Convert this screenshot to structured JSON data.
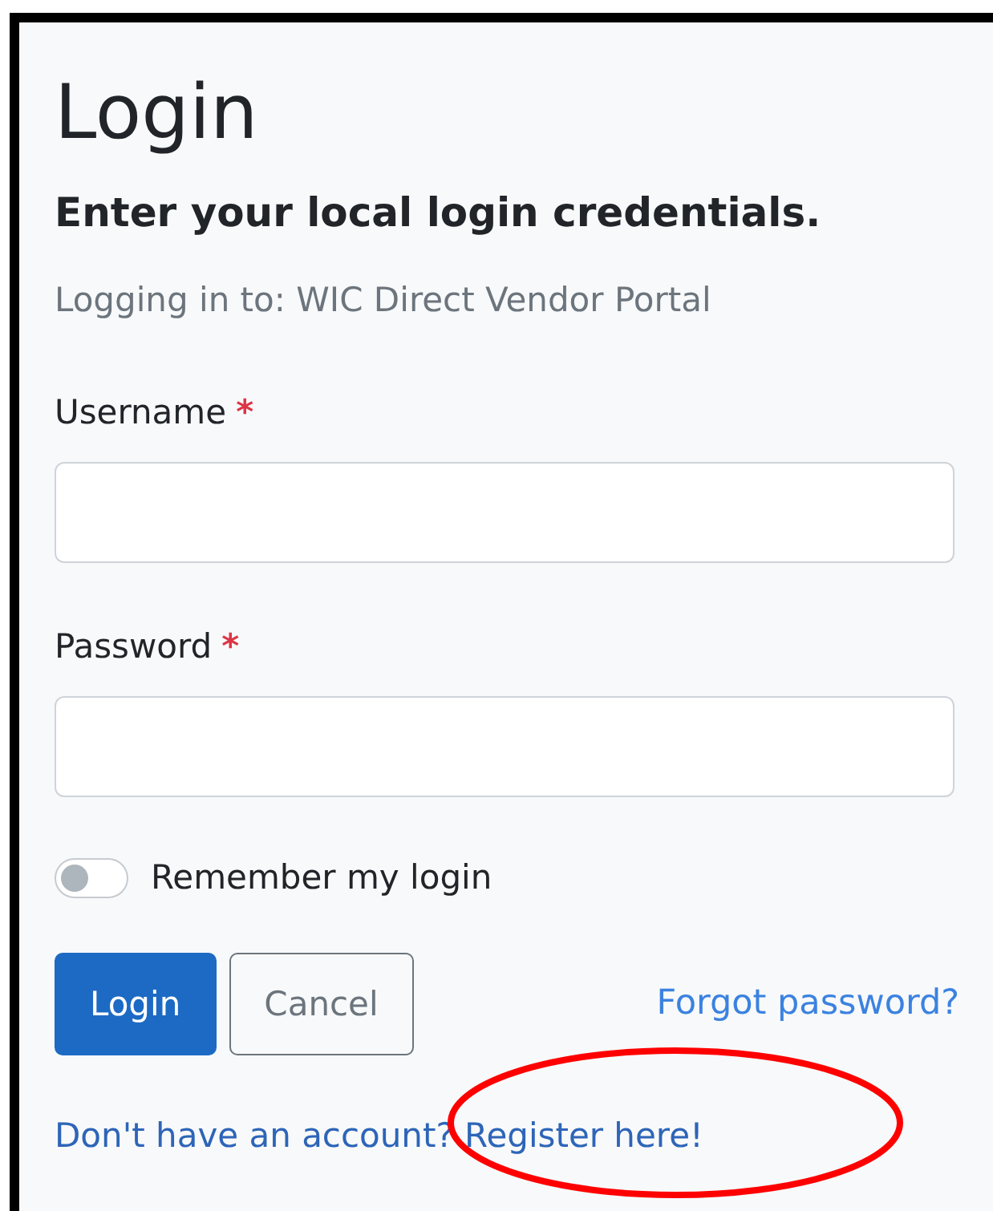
{
  "title": "Login",
  "subtitle": "Enter your local login credentials.",
  "context": "Logging in to: WIC Direct Vendor Portal",
  "fields": [
    {
      "label": "Username",
      "required_mark": "*"
    },
    {
      "label": "Password",
      "required_mark": "*"
    }
  ],
  "remember": {
    "label": "Remember my login",
    "on": false
  },
  "buttons": [
    {
      "label": "Login",
      "kind": "primary"
    },
    {
      "label": "Cancel",
      "kind": "secondary"
    }
  ],
  "forgot_link": "Forgot password?",
  "register_link": "Don't have an account? Register here!",
  "annotation": {
    "kind": "ellipse",
    "color": "#ff0000"
  }
}
